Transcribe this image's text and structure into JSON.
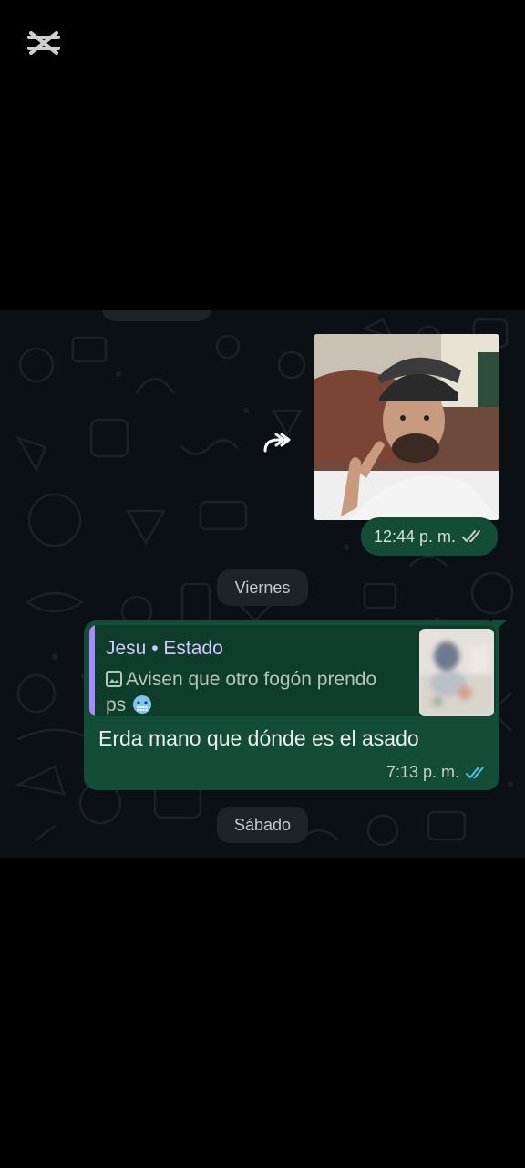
{
  "chat": {
    "image_message": {
      "time": "12:44 p. m."
    },
    "date_separators": [
      "Viernes",
      "Sábado"
    ],
    "reply_message": {
      "quote_author": "Jesu • Estado",
      "quote_text_line1": "Avisen que otro fogón prendo",
      "quote_text_line2": "ps",
      "text": "Erda mano que dónde es el asado",
      "time": "7:13 p. m."
    }
  },
  "icons": {
    "app_logo": "capcut-logo-icon",
    "forward": "forward-icon",
    "read_receipt": "double-check-icon",
    "photo": "photo-icon",
    "emoji": "cold-face-emoji-icon"
  },
  "colors": {
    "bubble": "#144d37",
    "quote_bar": "#a78bfa",
    "read_tick": "#53bdeb",
    "background": "#0b1014"
  }
}
